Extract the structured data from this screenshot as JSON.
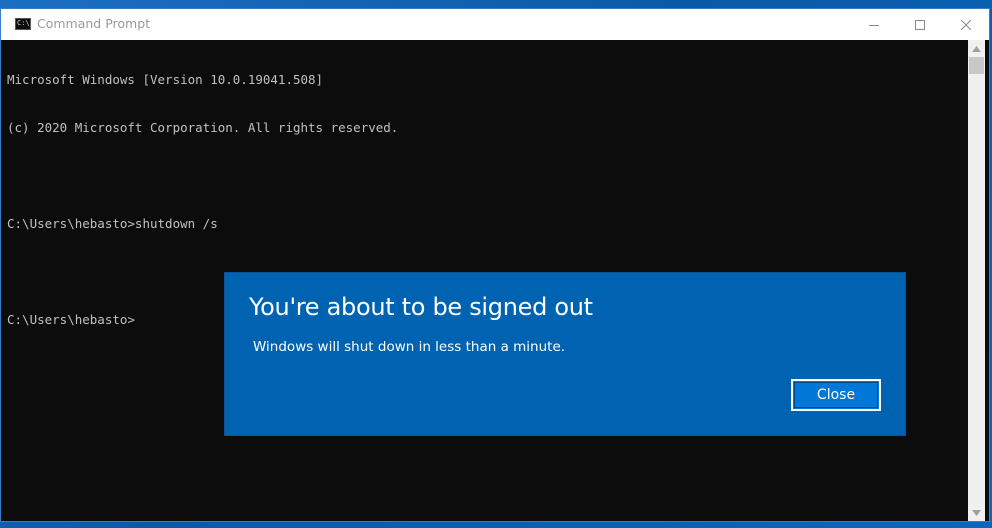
{
  "window": {
    "title": "Command Prompt",
    "icon": "cmd-icon",
    "icon_text": "C:\\_"
  },
  "console": {
    "lines": [
      "Microsoft Windows [Version 10.0.19041.508]",
      "(c) 2020 Microsoft Corporation. All rights reserved.",
      "",
      "C:\\Users\\hebasto>shutdown /s",
      "",
      "C:\\Users\\hebasto>"
    ]
  },
  "toast": {
    "title": "You're about to be signed out",
    "message": "Windows will shut down in less than a minute.",
    "close_label": "Close",
    "background": "#0063b1",
    "button_color": "#0078d7"
  },
  "colors": {
    "desktop": "#0b66bd",
    "console_bg": "#0c0c0c",
    "console_text": "#c0c0c0"
  }
}
